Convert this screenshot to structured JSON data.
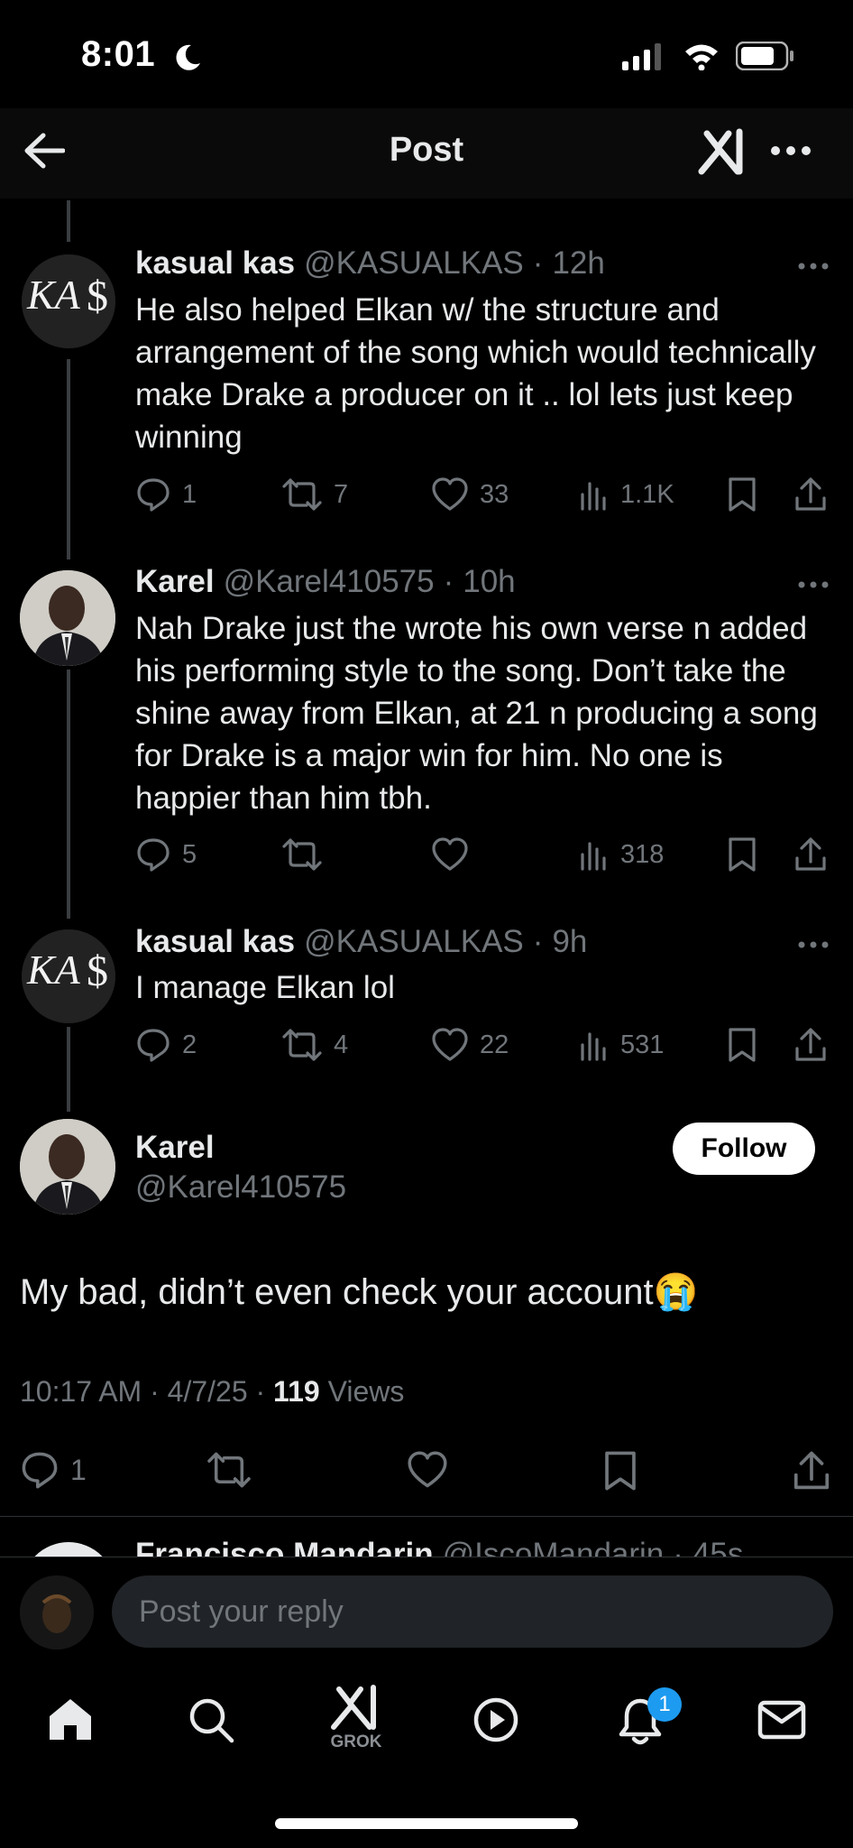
{
  "status_bar": {
    "time": "8:01"
  },
  "header": {
    "title": "Post"
  },
  "replies": [
    {
      "name": "kasual kas",
      "handle": "@KASUALKAS",
      "time": "12h",
      "text": "He also helped Elkan w/ the structure and arrangement of the song which would technically make Drake a producer on it .. lol lets just keep winning",
      "replies": "1",
      "reposts": "7",
      "likes": "33",
      "views": "1.1K"
    },
    {
      "name": "Karel",
      "handle": "@Karel410575",
      "time": "10h",
      "text": "Nah Drake just the wrote his own verse n added his performing style to the song. Don’t take the shine away from Elkan, at 21 n producing a song for Drake is a major win for him. No one is happier than him tbh.",
      "replies": "5",
      "reposts": "",
      "likes": "",
      "views": "318"
    },
    {
      "name": "kasual kas",
      "handle": "@KASUALKAS",
      "time": "9h",
      "text": "I manage Elkan lol",
      "replies": "2",
      "reposts": "4",
      "likes": "22",
      "views": "531"
    }
  ],
  "main_post": {
    "name": "Karel",
    "handle": "@Karel410575",
    "follow_label": "Follow",
    "text": "My bad, didn’t even check your account😭",
    "timestamp": "10:17 AM · 4/7/25 · ",
    "views_count": "119",
    "views_label": " Views",
    "reply_count": "1"
  },
  "next_reply_partial": {
    "name": "Francisco Mandarin",
    "handle": "@IscoMandarin",
    "time": "45s"
  },
  "reply_composer": {
    "placeholder": "Post your reply"
  },
  "tab_bar": {
    "grok_label": "GROK",
    "notification_count": "1"
  }
}
